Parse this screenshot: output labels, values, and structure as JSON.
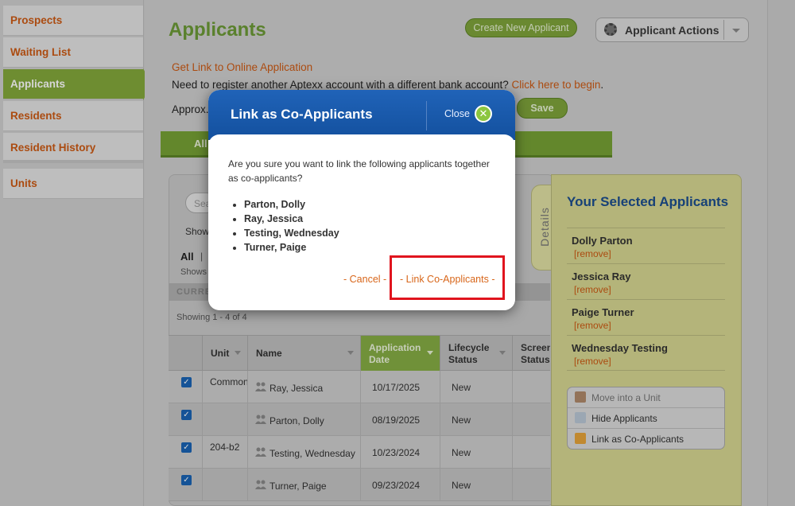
{
  "sidebar": {
    "items": [
      {
        "label": "Prospects",
        "active": false
      },
      {
        "label": "Waiting List",
        "active": false
      },
      {
        "label": "Applicants",
        "active": true
      },
      {
        "label": "Residents",
        "active": false
      },
      {
        "label": "Resident History",
        "active": false
      },
      {
        "label": "Units",
        "active": false
      }
    ]
  },
  "header": {
    "title": "Applicants",
    "create_button": "Create New Applicant",
    "actions_button": "Applicant Actions",
    "online_link": "Get Link to Online Application",
    "register_text": "Need to register another Aptexx account with a different bank account? ",
    "register_link": "Click here to begin",
    "register_end": ".",
    "approx_label": "Approx.",
    "save_button": "Save"
  },
  "tabs": {
    "all": "All"
  },
  "list": {
    "search_placeholder": "Sea",
    "show_label": "Show",
    "filter_all": "All",
    "filter_sep": "|",
    "shows_label": "Shows",
    "current_label": "CURRE",
    "showing_text": "Showing 1 - 4 of 4",
    "columns": [
      "Unit",
      "Name",
      "Application Date",
      "Lifecycle Status",
      "Screen Status"
    ],
    "rows": [
      {
        "checked": true,
        "unit": "Common",
        "name": "Ray, Jessica",
        "date": "10/17/2025",
        "status": "New"
      },
      {
        "checked": true,
        "unit": "",
        "name": "Parton, Dolly",
        "date": "08/19/2025",
        "status": "New"
      },
      {
        "checked": true,
        "unit": "204-b2",
        "name": "Testing, Wednesday",
        "date": "10/23/2024",
        "status": "New"
      },
      {
        "checked": true,
        "unit": "",
        "name": "Turner, Paige",
        "date": "09/23/2024",
        "status": "New"
      }
    ]
  },
  "details_tab": "Details",
  "selected": {
    "title": "Your Selected Applicants",
    "remove_label": "[remove]",
    "items": [
      "Dolly Parton",
      "Jessica Ray",
      "Paige Turner",
      "Wednesday Testing"
    ]
  },
  "actions": [
    {
      "label": "Move into a Unit",
      "icon": "move-unit-icon",
      "enabled": false
    },
    {
      "label": "Hide Applicants",
      "icon": "hide-icon",
      "enabled": true
    },
    {
      "label": "Link as Co-Applicants",
      "icon": "link-people-icon",
      "enabled": true
    }
  ],
  "dialog": {
    "title": "Link as Co-Applicants",
    "close_label": "Close",
    "question": "Are you sure you want to link the following applicants together as co-applicants?",
    "applicants": [
      "Parton, Dolly",
      "Ray, Jessica",
      "Testing, Wednesday",
      "Turner, Paige"
    ],
    "cancel_label": "- Cancel -",
    "confirm_label": "- Link Co-Applicants -"
  },
  "colors": {
    "brand_green": "#83a83b",
    "link_orange": "#cc5a14",
    "dialog_blue": "#1a5aad",
    "highlight_red": "#e0141e"
  }
}
